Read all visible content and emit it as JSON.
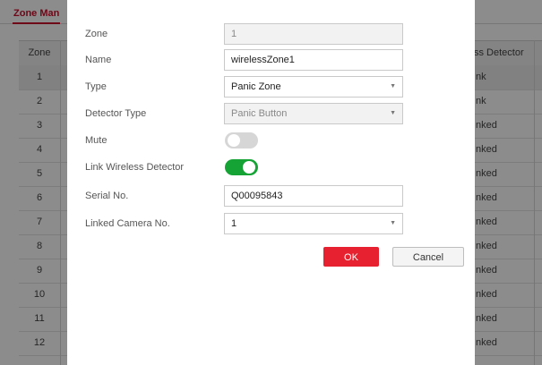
{
  "background": {
    "tab_label": "Zone Man",
    "table": {
      "col_zone": "Zone",
      "col_right": "ss Detector",
      "rows": [
        {
          "zone": "1",
          "right": "nk"
        },
        {
          "zone": "2",
          "right": "nk"
        },
        {
          "zone": "3",
          "right": "nked"
        },
        {
          "zone": "4",
          "right": "nked"
        },
        {
          "zone": "5",
          "right": "nked"
        },
        {
          "zone": "6",
          "right": "nked"
        },
        {
          "zone": "7",
          "right": "nked"
        },
        {
          "zone": "8",
          "right": "nked"
        },
        {
          "zone": "9",
          "right": "nked"
        },
        {
          "zone": "10",
          "right": "nked"
        },
        {
          "zone": "11",
          "right": "nked"
        },
        {
          "zone": "12",
          "right": "nked"
        }
      ]
    }
  },
  "dialog": {
    "zone": {
      "label": "Zone",
      "value": "1"
    },
    "name": {
      "label": "Name",
      "value": "wirelessZone1"
    },
    "type": {
      "label": "Type",
      "value": "Panic Zone"
    },
    "detector_type": {
      "label": "Detector Type",
      "value": "Panic Button"
    },
    "mute": {
      "label": "Mute",
      "enabled": false
    },
    "link_wireless": {
      "label": "Link Wireless Detector",
      "enabled": true
    },
    "serial": {
      "label": "Serial No.",
      "value": "Q00095843"
    },
    "linked_camera": {
      "label": "Linked Camera No.",
      "value": "1"
    },
    "ok_label": "OK",
    "cancel_label": "Cancel"
  },
  "colors": {
    "accent_red": "#e7212f",
    "toggle_on": "#16a336",
    "toggle_off": "#d6d6d6"
  },
  "icons": {
    "select_caret": "chevron-down-icon"
  }
}
